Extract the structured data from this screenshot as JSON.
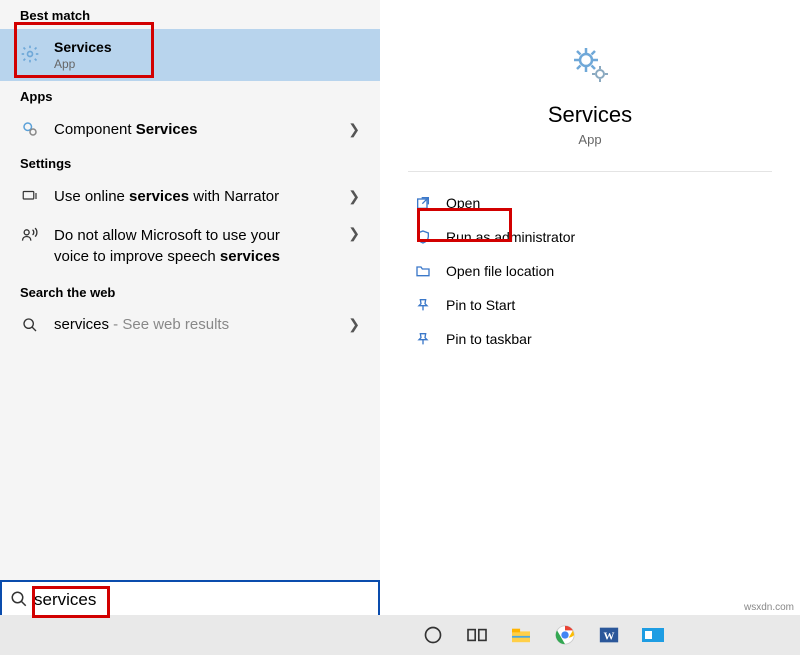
{
  "sections": {
    "best_match": "Best match",
    "apps": "Apps",
    "settings": "Settings",
    "search_web": "Search the web"
  },
  "best_match_item": {
    "title": "Services",
    "subtitle": "App"
  },
  "apps_results": {
    "component_prefix": "Component ",
    "component_bold": "Services"
  },
  "settings_results": {
    "narrator_prefix": "Use online ",
    "narrator_bold": "services",
    "narrator_suffix": " with Narrator",
    "speech_line1": "Do not allow Microsoft to use your",
    "speech_line2_prefix": "voice to improve speech ",
    "speech_line2_bold": "services"
  },
  "web_results": {
    "term": "services",
    "suffix": " - See web results"
  },
  "hero": {
    "title": "Services",
    "subtitle": "App"
  },
  "actions": {
    "open": "Open",
    "run_admin": "Run as administrator",
    "open_location": "Open file location",
    "pin_start": "Pin to Start",
    "pin_taskbar": "Pin to taskbar"
  },
  "search": {
    "value": "services"
  },
  "watermark": "wsxdn.com"
}
